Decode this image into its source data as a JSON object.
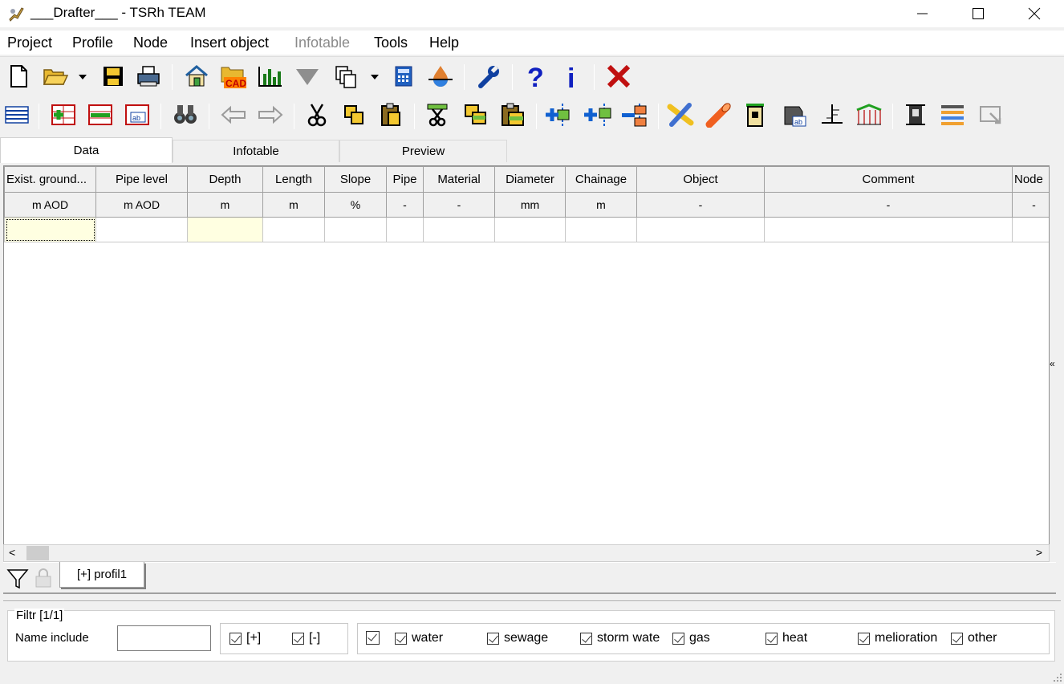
{
  "window": {
    "title": "___Drafter___ - TSRh TEAM",
    "minimize_icon": "minimize-icon",
    "maximize_icon": "maximize-icon",
    "close_icon": "close-icon"
  },
  "menu": {
    "items": [
      {
        "label": "Project",
        "enabled": true
      },
      {
        "label": "Profile",
        "enabled": true
      },
      {
        "label": "Node",
        "enabled": true
      },
      {
        "label": "Insert object",
        "enabled": true
      },
      {
        "label": "Infotable",
        "enabled": false
      },
      {
        "label": "Tools",
        "enabled": true
      },
      {
        "label": "Help",
        "enabled": true
      }
    ]
  },
  "toolbar1": {
    "icons": [
      "new-document-icon",
      "open-folder-icon",
      "save-icon",
      "print-icon",
      "home-icon",
      "cad-import-icon",
      "chart-icon",
      "funnel-icon",
      "copy-pages-icon",
      "calculator-icon",
      "water-drop-icon",
      "wrench-icon",
      "help-icon",
      "info-icon",
      "delete-icon"
    ]
  },
  "toolbar2": {
    "icons": [
      "grid-view-icon",
      "add-row-icon",
      "remove-row-icon",
      "table-edit-icon",
      "binoculars-icon",
      "arrow-left-icon",
      "arrow-right-icon",
      "scissors-icon",
      "copy-icon",
      "paste-icon",
      "cut-rows-icon",
      "copy-rows-icon",
      "paste-rows-icon",
      "insert-node-before-icon",
      "insert-node-after-icon",
      "remove-node-icon",
      "pipe-crossing-icon",
      "pipe-orange-icon",
      "manhole-icon",
      "manhole-label-icon",
      "level-marker-icon",
      "section-icon",
      "structure-icon",
      "layers-icon",
      "export-icon"
    ]
  },
  "tabs": [
    {
      "label": "Data",
      "active": true
    },
    {
      "label": "Infotable",
      "active": false
    },
    {
      "label": "Preview",
      "active": false
    }
  ],
  "grid": {
    "columns": [
      {
        "header": "Exist. ground...",
        "unit": "m AOD"
      },
      {
        "header": "Pipe level",
        "unit": "m AOD"
      },
      {
        "header": "Depth",
        "unit": "m"
      },
      {
        "header": "Length",
        "unit": "m"
      },
      {
        "header": "Slope",
        "unit": "%"
      },
      {
        "header": "Pipe",
        "unit": "-"
      },
      {
        "header": "Material",
        "unit": "-"
      },
      {
        "header": "Diameter",
        "unit": "mm"
      },
      {
        "header": "Chainage",
        "unit": "m"
      },
      {
        "header": "Object",
        "unit": "-"
      },
      {
        "header": "Comment",
        "unit": "-"
      },
      {
        "header": "Node",
        "unit": "-"
      }
    ],
    "collapse_glyph": "«",
    "scroll_left": "<",
    "scroll_right": ">"
  },
  "profile_tab": {
    "label": "[+] profil1",
    "filter_icon": "filter-icon",
    "lock_icon": "lock-icon"
  },
  "filter": {
    "legend": "Filtr [1/1]",
    "name_include_label": "Name include",
    "name_include_value": "",
    "plus_label": "[+]",
    "minus_label": "[-]",
    "types": [
      {
        "label": "water",
        "checked": true
      },
      {
        "label": "sewage",
        "checked": true
      },
      {
        "label": "storm wate",
        "checked": true
      },
      {
        "label": "gas",
        "checked": true
      },
      {
        "label": "heat",
        "checked": true
      },
      {
        "label": "melioration",
        "checked": true
      },
      {
        "label": "other",
        "checked": true
      }
    ]
  }
}
